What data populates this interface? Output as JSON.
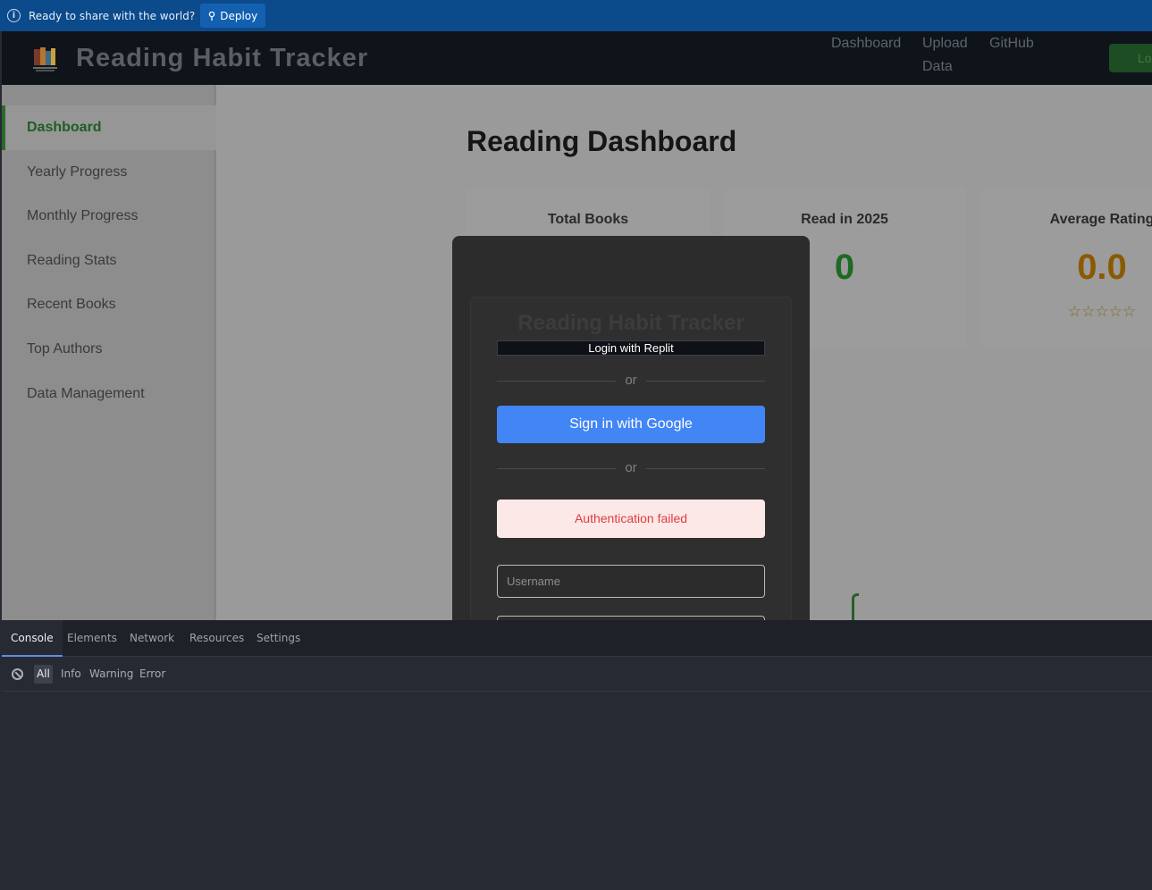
{
  "deploy_bar": {
    "message": "Ready to share with the world?",
    "deploy_label": "Deploy"
  },
  "header": {
    "title": "Reading Habit Tracker",
    "nav": [
      "Dashboard",
      "Upload",
      "Data",
      "GitHub"
    ],
    "login_label": "Lo"
  },
  "sidebar": {
    "items": [
      {
        "label": "Dashboard",
        "active": true
      },
      {
        "label": "Yearly Progress"
      },
      {
        "label": "Monthly Progress"
      },
      {
        "label": "Reading Stats"
      },
      {
        "label": "Recent Books"
      },
      {
        "label": "Top Authors"
      },
      {
        "label": "Data Management"
      }
    ]
  },
  "main": {
    "title": "Reading Dashboard",
    "cards": [
      {
        "label": "Total Books",
        "value": ""
      },
      {
        "label": "Read in 2025",
        "value": "0",
        "color": "#1e6a24"
      },
      {
        "label": "Average Rating",
        "value": "0.0",
        "color": "#8a5a00",
        "stars": "☆☆☆☆☆"
      }
    ]
  },
  "modal": {
    "title": "Reading Habit Tracker",
    "replit_label": "Login with Replit",
    "or_text": "or",
    "google_label": "Sign in with Google",
    "error_text": "Authentication failed",
    "username_placeholder": "Username",
    "username_value": ""
  },
  "devtools": {
    "tabs": [
      "Console",
      "Elements",
      "Network",
      "Resources",
      "Settings"
    ],
    "active_tab": "Console",
    "filters": [
      "All",
      "Info",
      "Warning",
      "Error"
    ],
    "active_filter": "All"
  }
}
